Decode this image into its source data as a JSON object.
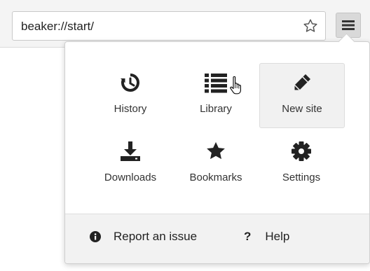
{
  "address_bar": {
    "url": "beaker://start/"
  },
  "icons": {
    "bookmark_star": "star-outline-icon",
    "menu": "hamburger-menu-icon"
  },
  "menu": {
    "tiles": [
      {
        "label": "History",
        "icon": "history-icon"
      },
      {
        "label": "Library",
        "icon": "list-icon"
      },
      {
        "label": "New site",
        "icon": "pencil-icon",
        "state": "hovered"
      },
      {
        "label": "Downloads",
        "icon": "download-icon"
      },
      {
        "label": "Bookmarks",
        "icon": "star-icon"
      },
      {
        "label": "Settings",
        "icon": "gear-icon"
      }
    ],
    "footer": {
      "report_label": "Report an issue",
      "help_label": "Help"
    }
  },
  "colors": {
    "icon": "#222222",
    "hover_bg": "#f1f1f1",
    "footer_bg": "#f2f2f2"
  }
}
